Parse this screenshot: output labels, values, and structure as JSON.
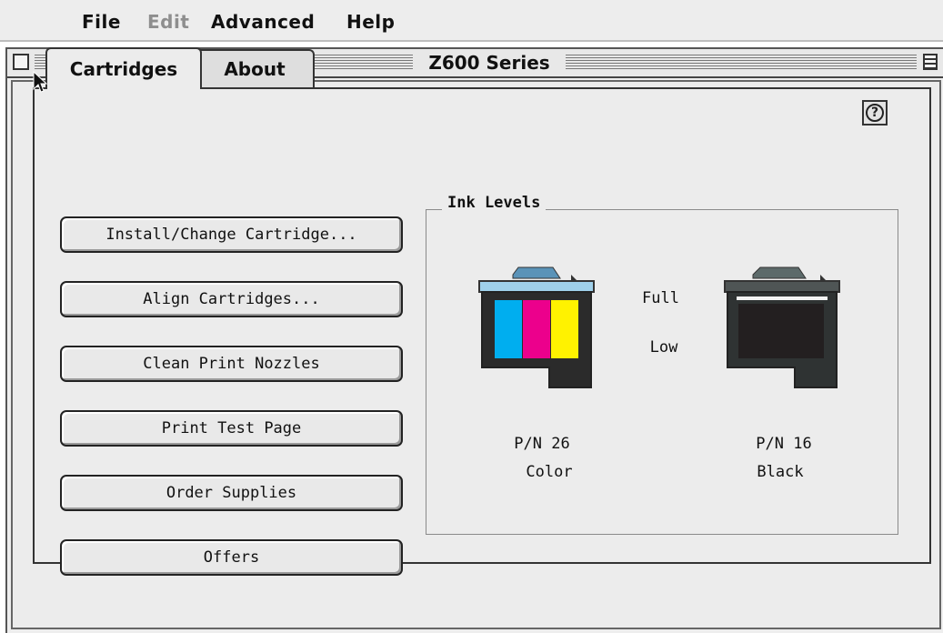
{
  "menubar": {
    "items": [
      {
        "label": "File",
        "enabled": true
      },
      {
        "label": "Edit",
        "enabled": false
      },
      {
        "label": "Advanced",
        "enabled": true
      },
      {
        "label": "Help",
        "enabled": true
      }
    ]
  },
  "window": {
    "title": "Z600 Series"
  },
  "tabs": [
    {
      "label": "Cartridges",
      "selected": true
    },
    {
      "label": "About",
      "selected": false
    }
  ],
  "help_button": {
    "icon": "question-mark-icon",
    "glyph": "?"
  },
  "actions": [
    {
      "label": "Install/Change Cartridge..."
    },
    {
      "label": "Align Cartridges..."
    },
    {
      "label": "Clean Print Nozzles"
    },
    {
      "label": "Print Test Page"
    },
    {
      "label": "Order Supplies"
    },
    {
      "label": "Offers"
    }
  ],
  "ink_levels": {
    "title": "Ink Levels",
    "scale_full": "Full",
    "scale_low": "Low",
    "cartridges": [
      {
        "part_number": "P/N 26",
        "type": "Color",
        "colors": [
          "#00aeef",
          "#ec008c",
          "#fff200"
        ]
      },
      {
        "part_number": "P/N 16",
        "type": "Black",
        "colors": [
          "#231f20"
        ]
      }
    ]
  }
}
